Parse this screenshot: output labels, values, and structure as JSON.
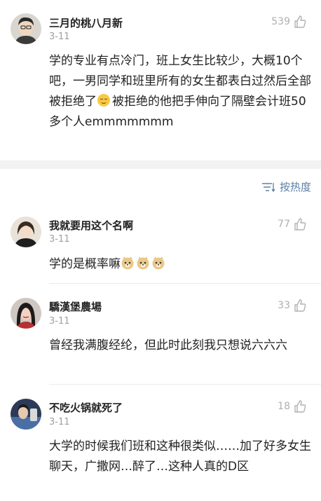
{
  "top_comment": {
    "username": "三月的桃八月新",
    "date": "3-11",
    "likes": "539",
    "text_before_emoji": "学的专业有点冷门，班上女生比较少，大概10个吧，一男同学和班里所有的女生都表白过然后全部被拒绝了",
    "emoji": "relieved-face-emoji",
    "text_after_emoji": "被拒绝的他把手伸向了隔壁会计班50多个人emmmmmmm"
  },
  "sort_control": {
    "icon": "sort-icon",
    "label": "按热度"
  },
  "comments": [
    {
      "username": "我就要用这个名啊",
      "date": "3-11",
      "likes": "77",
      "text": "学的是概率嘛",
      "emojis": [
        "doge-emoji",
        "doge-emoji",
        "doge-emoji"
      ]
    },
    {
      "username": "驕漢堡農場",
      "date": "3-11",
      "likes": "33",
      "text": "曾经我满腹经纶，但此时此刻我只想说六六六"
    },
    {
      "username": "不吃火锅就死了",
      "date": "3-11",
      "likes": "18",
      "text": "大学的时候我们班和这种很类似……加了好多女生聊天，广撒网…醉了…这种人真的D区"
    }
  ],
  "colors": {
    "link_blue": "#5b7fa6",
    "muted_gray": "#a0a0a0",
    "band_gray": "#f2f2f2"
  }
}
